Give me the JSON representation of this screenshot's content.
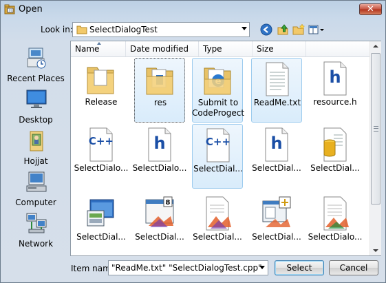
{
  "window": {
    "title": "Open"
  },
  "toolbar": {
    "lookin_label": "Look in:",
    "lookin_value": "SelectDialogTest"
  },
  "places": [
    {
      "label": "Recent Places",
      "icon": "recent-places-icon"
    },
    {
      "label": "Desktop",
      "icon": "desktop-icon"
    },
    {
      "label": "Hojjat",
      "icon": "user-folder-icon"
    },
    {
      "label": "Computer",
      "icon": "computer-icon"
    },
    {
      "label": "Network",
      "icon": "network-icon"
    }
  ],
  "columns": [
    "Name",
    "Date modified",
    "Type",
    "Size"
  ],
  "files": [
    {
      "name": "Release",
      "icon": "folder"
    },
    {
      "name": "res",
      "icon": "folder-doc"
    },
    {
      "name": "Submit to CodeProgect",
      "icon": "folder-ie"
    },
    {
      "name": "ReadMe.txt",
      "icon": "text"
    },
    {
      "name": "resource.h",
      "icon": "h"
    },
    {
      "name": "SelectDialo...",
      "icon": "cpp"
    },
    {
      "name": "SelectDialo...",
      "icon": "h"
    },
    {
      "name": "SelectDial...",
      "icon": "cpp"
    },
    {
      "name": "SelectDial...",
      "icon": "h"
    },
    {
      "name": "SelectDial...",
      "icon": "db"
    },
    {
      "name": "SelectDial...",
      "icon": "app-window"
    },
    {
      "name": "SelectDial...",
      "icon": "dialog"
    },
    {
      "name": "SelectDial...",
      "icon": "vs-doc"
    },
    {
      "name": "SelectDial...",
      "icon": "layout"
    },
    {
      "name": "SelectDialo...",
      "icon": "vs-doc2"
    }
  ],
  "footer": {
    "item_name_label": "Item name:",
    "item_name_value": "\"ReadMe.txt\" \"SelectDialogTest.cpp\"",
    "select_label": "Select",
    "cancel_label": "Cancel"
  },
  "colors": {
    "selection": "#d9ecfb",
    "selection_border": "#9ccbee",
    "close": "#c5513f"
  }
}
